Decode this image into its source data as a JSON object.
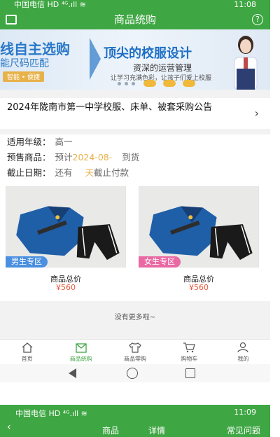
{
  "status_bar": {
    "carrier": "中国电信",
    "signal_icons": "HD ⁴ᴳ.ıll ≋",
    "time": "11:08"
  },
  "header": {
    "title": "商品统购",
    "help_icon": "?"
  },
  "banner": {
    "left_text_1": "线自主选购",
    "left_text_2": "能尺码匹配",
    "left_tag": "智能 • 便捷",
    "title": "顶尖的校服设计",
    "subtitle": "资深的运营管理",
    "tagline": "让学习充满色彩，让孩子们爱上校服"
  },
  "notice": {
    "title": "2024年陇南市第一中学校服、床单、被套采购公告"
  },
  "info": {
    "grade_label": "适用年级：",
    "grade_value": "高一",
    "presale_label": "预售商品：",
    "presale_prefix": "预计",
    "presale_date": "2024-08-",
    "presale_suffix": "到货",
    "deadline_label": "截止日期：",
    "deadline_prefix": "还有",
    "deadline_days": "天",
    "deadline_suffix": "截止付款"
  },
  "products": [
    {
      "badge": "男生专区",
      "name": "商品总价",
      "price": "¥560",
      "badge_color": "#4a8fe0"
    },
    {
      "badge": "女生专区",
      "name": "商品总价",
      "price": "¥560",
      "badge_color": "#e96aa3"
    }
  ],
  "no_more": "没有更多啦~",
  "tabs": [
    {
      "label": "首页",
      "icon": "home-icon"
    },
    {
      "label": "商品统购",
      "icon": "bag-icon"
    },
    {
      "label": "商品零购",
      "icon": "shirt-icon"
    },
    {
      "label": "购物车",
      "icon": "cart-icon"
    },
    {
      "label": "我的",
      "icon": "user-icon"
    }
  ],
  "second_screen": {
    "carrier": "中国电信",
    "signal_icons": "HD ⁴ᴳ.ıll ≋",
    "time": "11:09",
    "tabs": [
      "商品",
      "详情",
      "常见问题"
    ]
  },
  "colors": {
    "accent": "#3ea642",
    "price": "#e85a3c",
    "highlight": "#e8b24a"
  }
}
